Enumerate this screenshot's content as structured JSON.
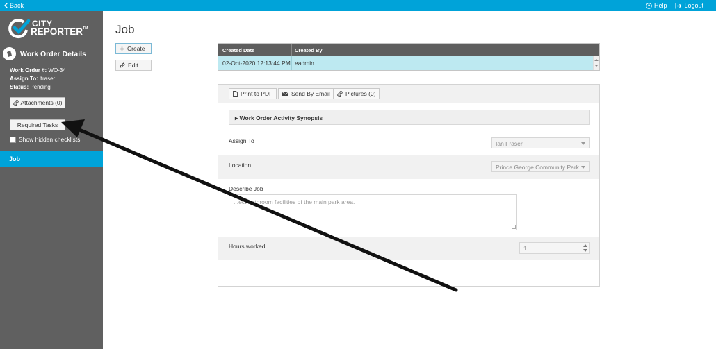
{
  "topbar": {
    "back_label": "Back",
    "help_label": "Help",
    "logout_label": "Logout"
  },
  "logo": {
    "line1": "CITY",
    "line2": "REPORTER",
    "tm": "TM"
  },
  "sidebar": {
    "section_title": "Work Order Details",
    "work_order_label": "Work Order #:",
    "work_order_value": "WO-34",
    "assign_label": "Assign To:",
    "assign_value": "lfraser",
    "status_label": "Status:",
    "status_value": "Pending",
    "attachments_label": "Attachments (0)",
    "required_tasks_label": "Required Tasks",
    "show_hidden_label": "Show hidden checklists",
    "nav_job_label": "Job"
  },
  "main": {
    "page_title": "Job",
    "create_label": "Create",
    "edit_label": "Edit"
  },
  "grid": {
    "columns": [
      "Created Date",
      "Created By"
    ],
    "rows": [
      [
        "02-Oct-2020 12:13:44 PM",
        "eadmin"
      ]
    ]
  },
  "form": {
    "toolbar": {
      "pdf_label": "Print to PDF",
      "email_label": "Send By Email",
      "pictures_label": "Pictures (0)"
    },
    "synopsis_label": "Work Order Activity Synopsis",
    "assign_to_label": "Assign To",
    "assign_to_value": "Ian Fraser",
    "location_label": "Location",
    "location_value": "Prince George Community Park",
    "describe_label": "Describe Job",
    "describe_value": "...ect bathroom facilities of the main park area.",
    "hours_label": "Hours worked",
    "hours_value": "1"
  },
  "colors": {
    "accent": "#00a3d9",
    "sidebar": "#606060",
    "selected_row": "#bde9f1",
    "grid_header": "#5e5e5e"
  }
}
